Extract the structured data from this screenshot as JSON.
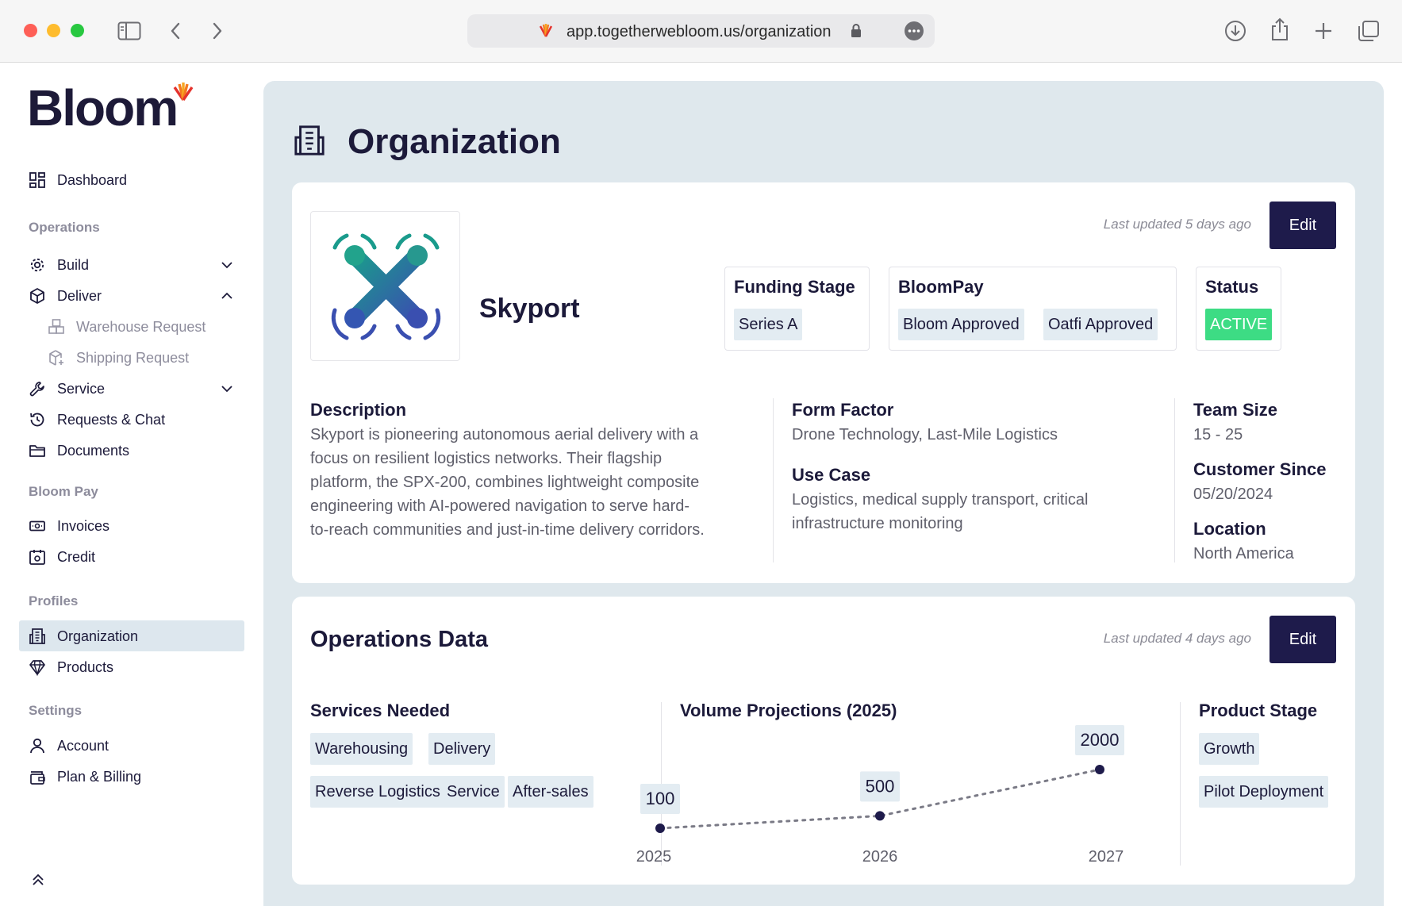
{
  "browser": {
    "url": "app.togetherwebloom.us/organization"
  },
  "brand": {
    "logo_text": "Bloom"
  },
  "sidebar": {
    "dashboard": "Dashboard",
    "sections": {
      "operations": "Operations",
      "bloom_pay": "Bloom Pay",
      "profiles": "Profiles",
      "settings": "Settings"
    },
    "items": {
      "build": "Build",
      "deliver": "Deliver",
      "warehouse_request": "Warehouse Request",
      "shipping_request": "Shipping Request",
      "service": "Service",
      "requests_chat": "Requests & Chat",
      "documents": "Documents",
      "invoices": "Invoices",
      "credit": "Credit",
      "organization": "Organization",
      "products": "Products",
      "account": "Account",
      "plan_billing": "Plan & Billing"
    }
  },
  "page": {
    "title": "Organization"
  },
  "organization": {
    "last_updated": "Last updated 5 days ago",
    "edit_label": "Edit",
    "name": "Skyport",
    "funding_stage": {
      "label": "Funding Stage",
      "value": "Series A"
    },
    "bloompay": {
      "label": "BloomPay",
      "values": [
        "Bloom Approved",
        "Oatfi Approved"
      ]
    },
    "status": {
      "label": "Status",
      "value": "ACTIVE"
    },
    "description": {
      "label": "Description",
      "text": "Skyport is pioneering autonomous aerial delivery with a focus on resilient logistics networks. Their flagship platform, the SPX-200, combines lightweight composite engineering with AI-powered navigation to serve hard-to-reach communities and just-in-time delivery corridors."
    },
    "form_factor": {
      "label": "Form Factor",
      "value": "Drone Technology, Last-Mile Logistics"
    },
    "use_case": {
      "label": "Use Case",
      "value": "Logistics, medical supply transport, critical infrastructure monitoring"
    },
    "team_size": {
      "label": "Team Size",
      "value": "15 - 25"
    },
    "customer_since": {
      "label": "Customer Since",
      "value": "05/20/2024"
    },
    "location": {
      "label": "Location",
      "value": "North America"
    }
  },
  "operations": {
    "title": "Operations Data",
    "last_updated": "Last updated 4 days ago",
    "edit_label": "Edit",
    "services_needed": {
      "label": "Services Needed",
      "items": [
        "Warehousing",
        "Delivery",
        "Reverse Logistics",
        "Service",
        "After-sales"
      ]
    },
    "volume_label": "Volume Projections (2025)",
    "product_stage": {
      "label": "Product Stage",
      "items": [
        "Growth",
        "Pilot Deployment"
      ]
    }
  },
  "chart_data": {
    "type": "line",
    "title": "Volume Projections (2025)",
    "x": [
      "2025",
      "2026",
      "2027"
    ],
    "series": [
      {
        "values": [
          100,
          500,
          2000
        ]
      }
    ],
    "data_labels": [
      "100",
      "500",
      "2000"
    ],
    "line_style": "dotted",
    "grid": false
  },
  "colors": {
    "brand_navy": "#1e1b4b",
    "active_green": "#3ddc84",
    "chip_bg": "#e3ecf2",
    "main_bg": "#dfe8ed"
  }
}
